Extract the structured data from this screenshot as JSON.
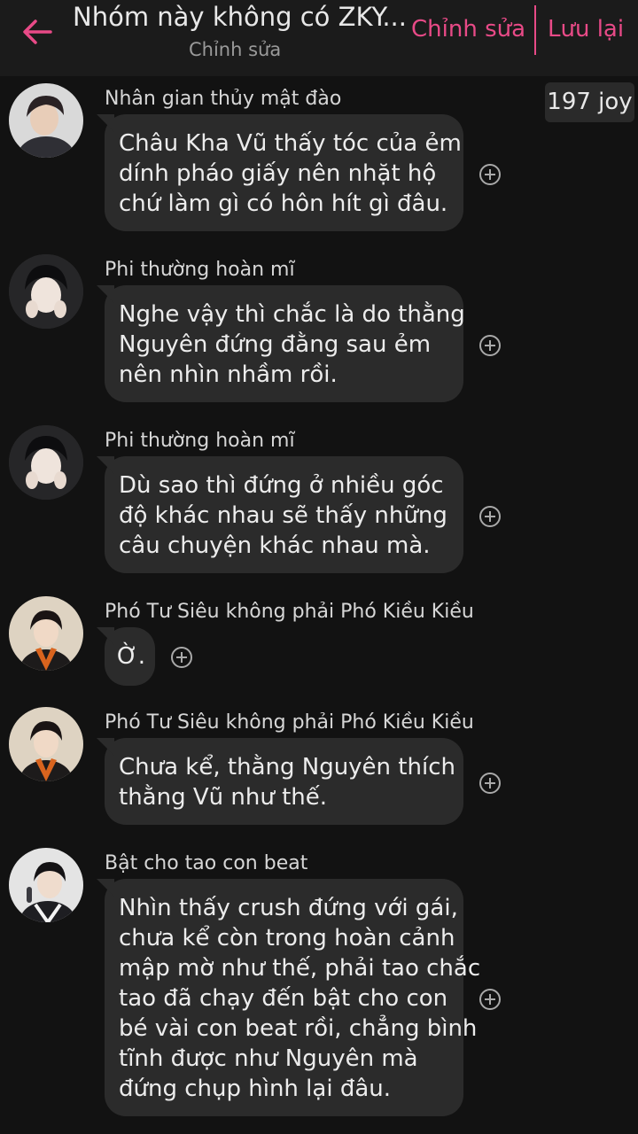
{
  "header": {
    "title": "Nhóm này không có ZKY...",
    "subtitle": "Chỉnh sửa",
    "edit_label": "Chỉnh sửa",
    "save_label": "Lưu lại",
    "accent_color": "#e84a87"
  },
  "joy_badge": "197 joy",
  "messages": [
    {
      "sender": "Nhân gian thủy mật đào",
      "lines": [
        "Châu Kha Vũ thấy tóc của ẻm",
        "dính pháo giấy nên nhặt hộ",
        "chứ làm gì có hôn hít gì đâu."
      ]
    },
    {
      "sender": "Phi thường hoàn mĩ",
      "lines": [
        "Nghe vậy thì chắc là do thằng",
        "Nguyên đứng đằng sau ẻm",
        "nên nhìn nhầm rồi."
      ]
    },
    {
      "sender": "Phi thường hoàn mĩ",
      "lines": [
        "Dù sao thì đứng ở nhiều góc",
        "độ khác nhau sẽ thấy những",
        "câu chuyện khác nhau mà."
      ]
    },
    {
      "sender": "Phó Tư Siêu không phải Phó Kiều Kiều",
      "lines": [
        "Ờ."
      ]
    },
    {
      "sender": "Phó Tư Siêu không phải Phó Kiều Kiều",
      "lines": [
        "Chưa kể, thằng Nguyên thích",
        "thằng Vũ như thế."
      ]
    },
    {
      "sender": "Bật cho tao con beat",
      "lines": [
        "Nhìn thấy crush đứng với gái,",
        "chưa kể còn trong hoàn cảnh",
        "mập mờ như thế, phải tao chắc",
        "tao đã chạy đến bật cho con",
        "bé vài con beat rồi, chẳng bình",
        "tĩnh được như Nguyên mà",
        "đứng chụp hình lại đâu."
      ]
    }
  ]
}
